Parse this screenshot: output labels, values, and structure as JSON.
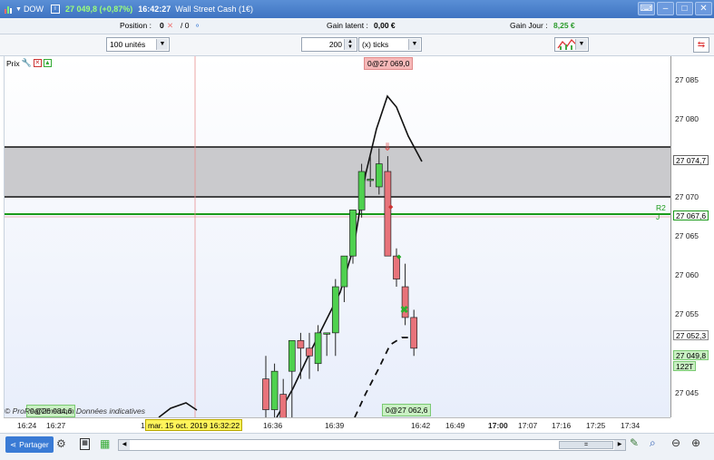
{
  "titlebar": {
    "symbol": "DOW",
    "price_change": "27 049,8 (+0,87%)",
    "time": "16:42:27",
    "instrument": "Wall Street Cash (1€)"
  },
  "infobar": {
    "position_label": "Position :",
    "position_value": "0",
    "position_sep": "/ 0",
    "gain_latent_label": "Gain latent :",
    "gain_latent_value": "0,00 €",
    "gain_jour_label": "Gain Jour :",
    "gain_jour_value": "8,25 €"
  },
  "toolbar": {
    "units_value": "100 unités",
    "ticks_count": "200",
    "ticks_unit": "(x) ticks"
  },
  "chart": {
    "prix_label": "Prix",
    "top_label": "0@27 069,0",
    "bottom_label": "0@27 062,6",
    "left_label": "0@26 084,6",
    "r2_label": "R2 J",
    "watermark": "© ProRealTime.com Données indicatives",
    "colors": {
      "up": "#4fd14f",
      "down": "#e8737a",
      "band": "#c4c4c8",
      "r2": "#1a9a1a"
    }
  },
  "yaxis": {
    "ticks": [
      "27 085",
      "27 080",
      "27 070",
      "27 065",
      "27 060",
      "27 055",
      "27 045"
    ],
    "boxes": {
      "band_top": "27 074,7",
      "r2": "27 067,6",
      "lower": "27 052,3",
      "current": "27 049,8",
      "volume": "122T"
    }
  },
  "xaxis": {
    "labels": [
      "16:24",
      "16:27",
      "16:36",
      "16:39",
      "16:42",
      "16:49",
      "17:00",
      "17:07",
      "17:16",
      "17:25",
      "17:34"
    ],
    "cursor_date": "mar. 15 oct. 2019 16:32:22",
    "cursor_prefix": "1"
  },
  "bottombar": {
    "share_label": "Partager",
    "scroll_mid": "="
  },
  "chart_data": {
    "type": "candlestick",
    "ylim": [
      27041,
      27088
    ],
    "candles": [
      {
        "o": 27046,
        "h": 27049,
        "l": 27034,
        "c": 27042
      },
      {
        "o": 27042,
        "h": 27048,
        "l": 27035,
        "c": 27047
      },
      {
        "o": 27044,
        "h": 27046,
        "l": 27038,
        "c": 27040
      },
      {
        "o": 27047,
        "h": 27051,
        "l": 27040,
        "c": 27051
      },
      {
        "o": 27051,
        "h": 27052,
        "l": 27046,
        "c": 27050
      },
      {
        "o": 27050,
        "h": 27052,
        "l": 27046,
        "c": 27049
      },
      {
        "o": 27048,
        "h": 27053,
        "l": 27047,
        "c": 27052
      },
      {
        "o": 27052,
        "h": 27052,
        "l": 27049,
        "c": 27052
      },
      {
        "o": 27052,
        "h": 27059,
        "l": 27049,
        "c": 27058
      },
      {
        "o": 27058,
        "h": 27062,
        "l": 27056,
        "c": 27062
      },
      {
        "o": 27062,
        "h": 27067,
        "l": 27061,
        "c": 27068
      },
      {
        "o": 27068,
        "h": 27074,
        "l": 27067,
        "c": 27073
      },
      {
        "o": 27072,
        "h": 27075,
        "l": 27071,
        "c": 27072
      },
      {
        "o": 27071,
        "h": 27076,
        "l": 27070,
        "c": 27074
      },
      {
        "o": 27073,
        "h": 27075,
        "l": 27062,
        "c": 27062
      },
      {
        "o": 27062,
        "h": 27063,
        "l": 27058,
        "c": 27059
      },
      {
        "o": 27058,
        "h": 27061,
        "l": 27053,
        "c": 27054
      },
      {
        "o": 27054,
        "h": 27055,
        "l": 27049,
        "c": 27050
      }
    ]
  }
}
